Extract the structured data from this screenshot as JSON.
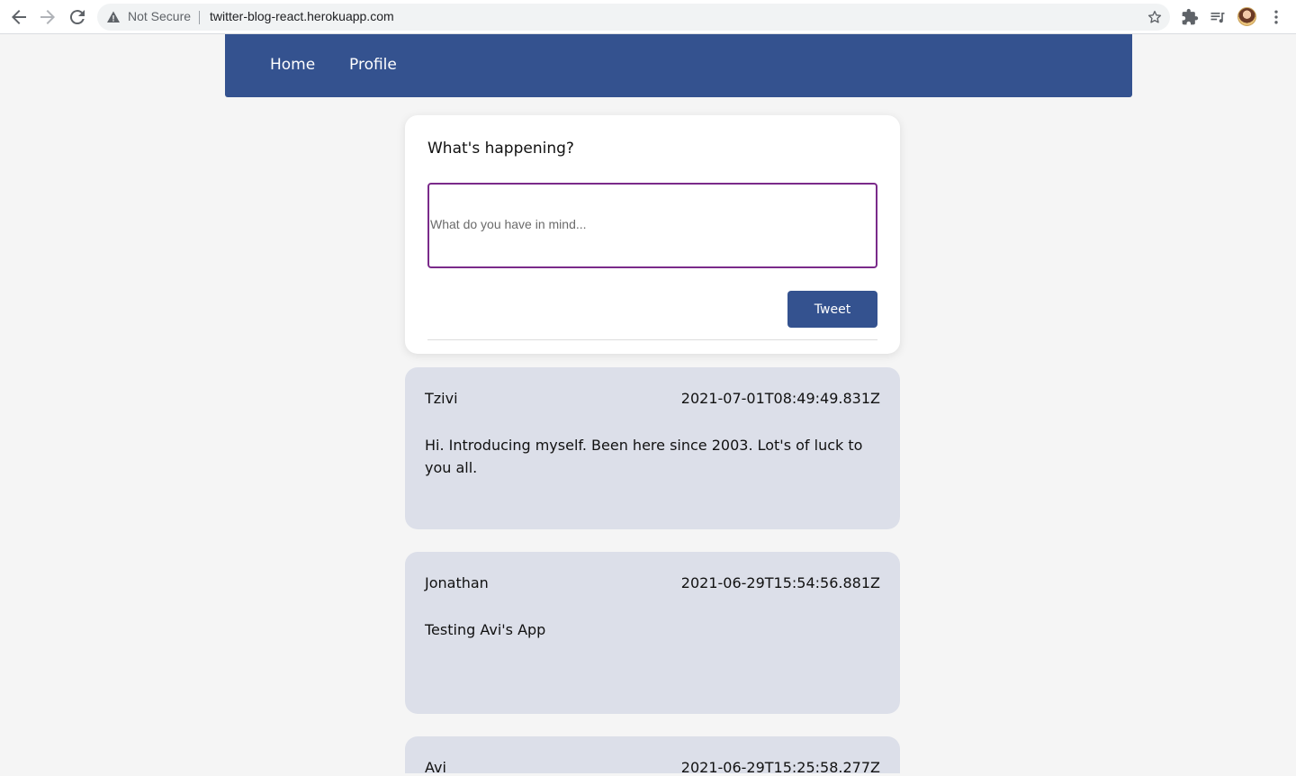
{
  "browser": {
    "security_label": "Not Secure",
    "url": "twitter-blog-react.herokuapp.com"
  },
  "nav": {
    "home": "Home",
    "profile": "Profile"
  },
  "compose": {
    "heading": "What's happening?",
    "placeholder": "What do you have in mind...",
    "value": "",
    "submit_label": "Tweet"
  },
  "posts": [
    {
      "author": "Tzivi",
      "timestamp": "2021-07-01T08:49:49.831Z",
      "text": "Hi. Introducing myself. Been here since 2003. Lot's of luck to you all."
    },
    {
      "author": "Jonathan",
      "timestamp": "2021-06-29T15:54:56.881Z",
      "text": "Testing Avi's App"
    },
    {
      "author": "Avi",
      "timestamp": "2021-06-29T15:25:58.277Z",
      "text": ""
    }
  ],
  "colors": {
    "brand": "#34528f",
    "post_background": "#dcdfe9",
    "input_border": "#7a2a8a",
    "page_background": "#f5f5f5"
  }
}
